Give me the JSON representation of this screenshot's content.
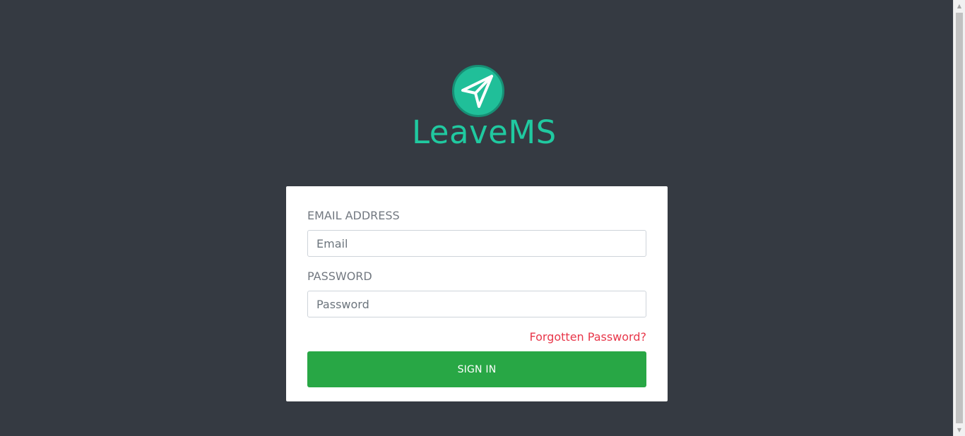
{
  "brand": {
    "name": "LeaveMS",
    "icon": "paper-plane-icon",
    "color": "#20c9a0"
  },
  "login": {
    "email_label": "EMAIL ADDRESS",
    "email_placeholder": "Email",
    "email_value": "",
    "password_label": "PASSWORD",
    "password_placeholder": "Password",
    "password_value": "",
    "forgot_password": "Forgotten Password?",
    "sign_in": "SIGN IN"
  },
  "colors": {
    "background": "#353a42",
    "card": "#ffffff",
    "primary_button": "#28a745",
    "link": "#e8374a"
  }
}
